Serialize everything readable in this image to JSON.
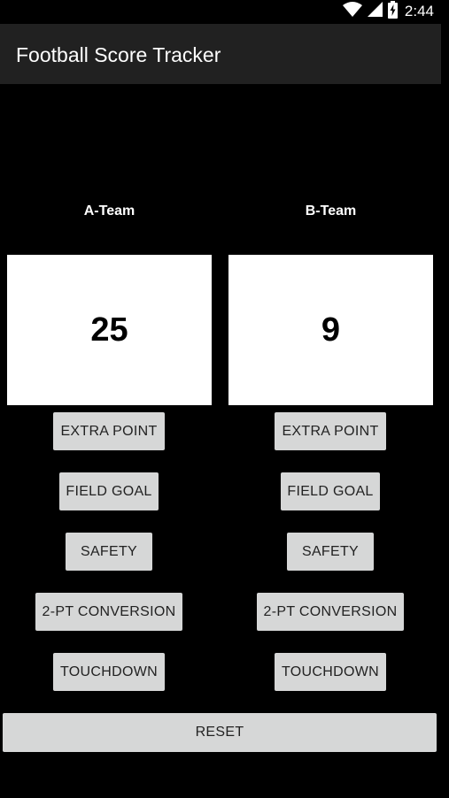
{
  "status_bar": {
    "time": "2:44",
    "icons": [
      "wifi-icon",
      "cell-signal-icon",
      "battery-charging-icon"
    ]
  },
  "app_bar": {
    "title": "Football Score Tracker"
  },
  "team_a": {
    "name": "A-Team",
    "score": "25",
    "buttons": {
      "extra_point": "EXTRA POINT",
      "field_goal": "FIELD GOAL",
      "safety": "SAFETY",
      "two_pt": "2-PT CONVERSION",
      "touchdown": "TOUCHDOWN"
    }
  },
  "team_b": {
    "name": "B-Team",
    "score": "9",
    "buttons": {
      "extra_point": "EXTRA POINT",
      "field_goal": "FIELD GOAL",
      "safety": "SAFETY",
      "two_pt": "2-PT CONVERSION",
      "touchdown": "TOUCHDOWN"
    }
  },
  "reset_label": "RESET",
  "colors": {
    "background": "#000000",
    "app_bar": "#212121",
    "button": "#d6d7d7",
    "score_box": "#ffffff"
  }
}
